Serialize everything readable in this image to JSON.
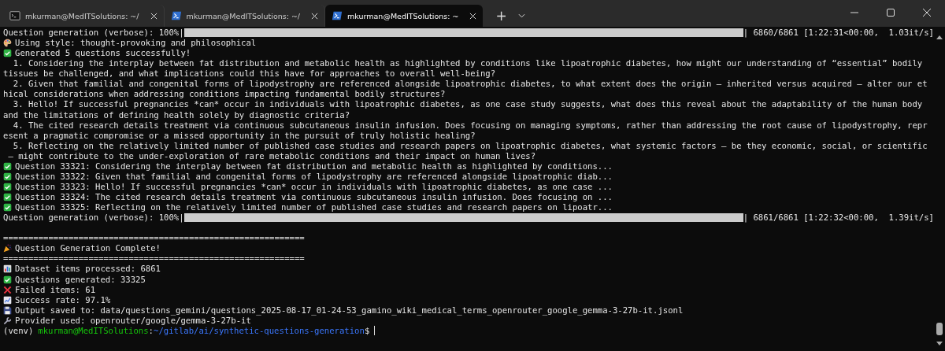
{
  "tabs": [
    {
      "title": "mkurman@MedITSolutions: ~/",
      "selected": false
    },
    {
      "title": "mkurman@MedITSolutions: ~/",
      "selected": false
    },
    {
      "title": "mkurman@MedITSolutions: ~",
      "selected": true
    }
  ],
  "new_tab": "+",
  "terminal": {
    "lines": [
      {
        "kind": "progress",
        "prefix": "Question generation (verbose): 100%|",
        "level": 1,
        "suffix": "| 6860/6861 [1:22:31<00:00,  1.03it/s]"
      },
      {
        "kind": "style",
        "text": "Using style: thought-provoking and philosophical"
      },
      {
        "kind": "success",
        "text": "Generated 5 questions successfully!"
      },
      {
        "kind": "question",
        "lines": [
          "  1. Considering the interplay between fat distribution and metabolic health as highlighted by conditions like lipoatrophic diabetes, how might our understanding of “essential” bodily",
          "tissues be challenged, and what implications could this have for approaches to overall well-being?"
        ]
      },
      {
        "kind": "question",
        "lines": [
          "  2. Given that familial and congenital forms of lipodystrophy are referenced alongside lipoatrophic diabetes, to what extent does the origin – inherited versus acquired – alter our et",
          "hical considerations when addressing conditions impacting fundamental bodily structures?"
        ]
      },
      {
        "kind": "question",
        "lines": [
          "  3. Hello! If successful pregnancies *can* occur in individuals with lipoatrophic diabetes, as one case study suggests, what does this reveal about the adaptability of the human body",
          "and the limitations of defining health solely by diagnostic criteria?"
        ]
      },
      {
        "kind": "question",
        "lines": [
          "  4. The cited research details treatment via continuous subcutaneous insulin infusion. Does focusing on managing symptoms, rather than addressing the root cause of lipodystrophy, repr",
          "esent a pragmatic compromise or a missed opportunity in the pursuit of truly holistic healing?"
        ]
      },
      {
        "kind": "question",
        "lines": [
          "  5. Reflecting on the relatively limited number of published case studies and research papers on lipoatrophic diabetes, what systemic factors – be they economic, social, or scientific",
          " – might contribute to the under-exploration of rare metabolic conditions and their impact on human lives?"
        ]
      },
      {
        "kind": "success",
        "text": "Question 33321: Considering the interplay between fat distribution and metabolic health as highlighted by conditions..."
      },
      {
        "kind": "success",
        "text": "Question 33322: Given that familial and congenital forms of lipodystrophy are referenced alongside lipoatrophic diab..."
      },
      {
        "kind": "success",
        "text": "Question 33323: Hello! If successful pregnancies *can* occur in individuals with lipoatrophic diabetes, as one case ..."
      },
      {
        "kind": "success",
        "text": "Question 33324: The cited research details treatment via continuous subcutaneous insulin infusion. Does focusing on ..."
      },
      {
        "kind": "success",
        "text": "Question 33325: Reflecting on the relatively limited number of published case studies and research papers on lipoatr..."
      },
      {
        "kind": "progress",
        "prefix": "Question generation (verbose): 100%|",
        "level": 1,
        "suffix": "| 6861/6861 [1:22:32<00:00,  1.39it/s]"
      },
      {
        "kind": "blank"
      },
      {
        "kind": "plain",
        "text": "============================================================"
      },
      {
        "kind": "celebration",
        "text": "Question Generation Complete!"
      },
      {
        "kind": "plain",
        "text": "============================================================"
      },
      {
        "kind": "stats",
        "text": "Dataset items processed: 6861"
      },
      {
        "kind": "success",
        "text": "Questions generated: 33325"
      },
      {
        "kind": "failure",
        "text": "Failed items: 61"
      },
      {
        "kind": "rate",
        "text": "Success rate: 97.1%"
      },
      {
        "kind": "saved",
        "text": "Output saved to: data/questions_gemini/questions_2025-08-17_01-24-53_gamino_wiki_medical_terms_openrouter_google_gemma-3-27b-it.jsonl"
      },
      {
        "kind": "provider",
        "text": "Provider used: openrouter/google/gemma-3-27b-it"
      },
      {
        "kind": "prompt",
        "env": "(venv)",
        "user_host": "mkurman@MedITSolutions",
        "separator": ":",
        "path": "~/gitlab/ai/synthetic-questions-generation",
        "symbol": "$"
      }
    ]
  }
}
